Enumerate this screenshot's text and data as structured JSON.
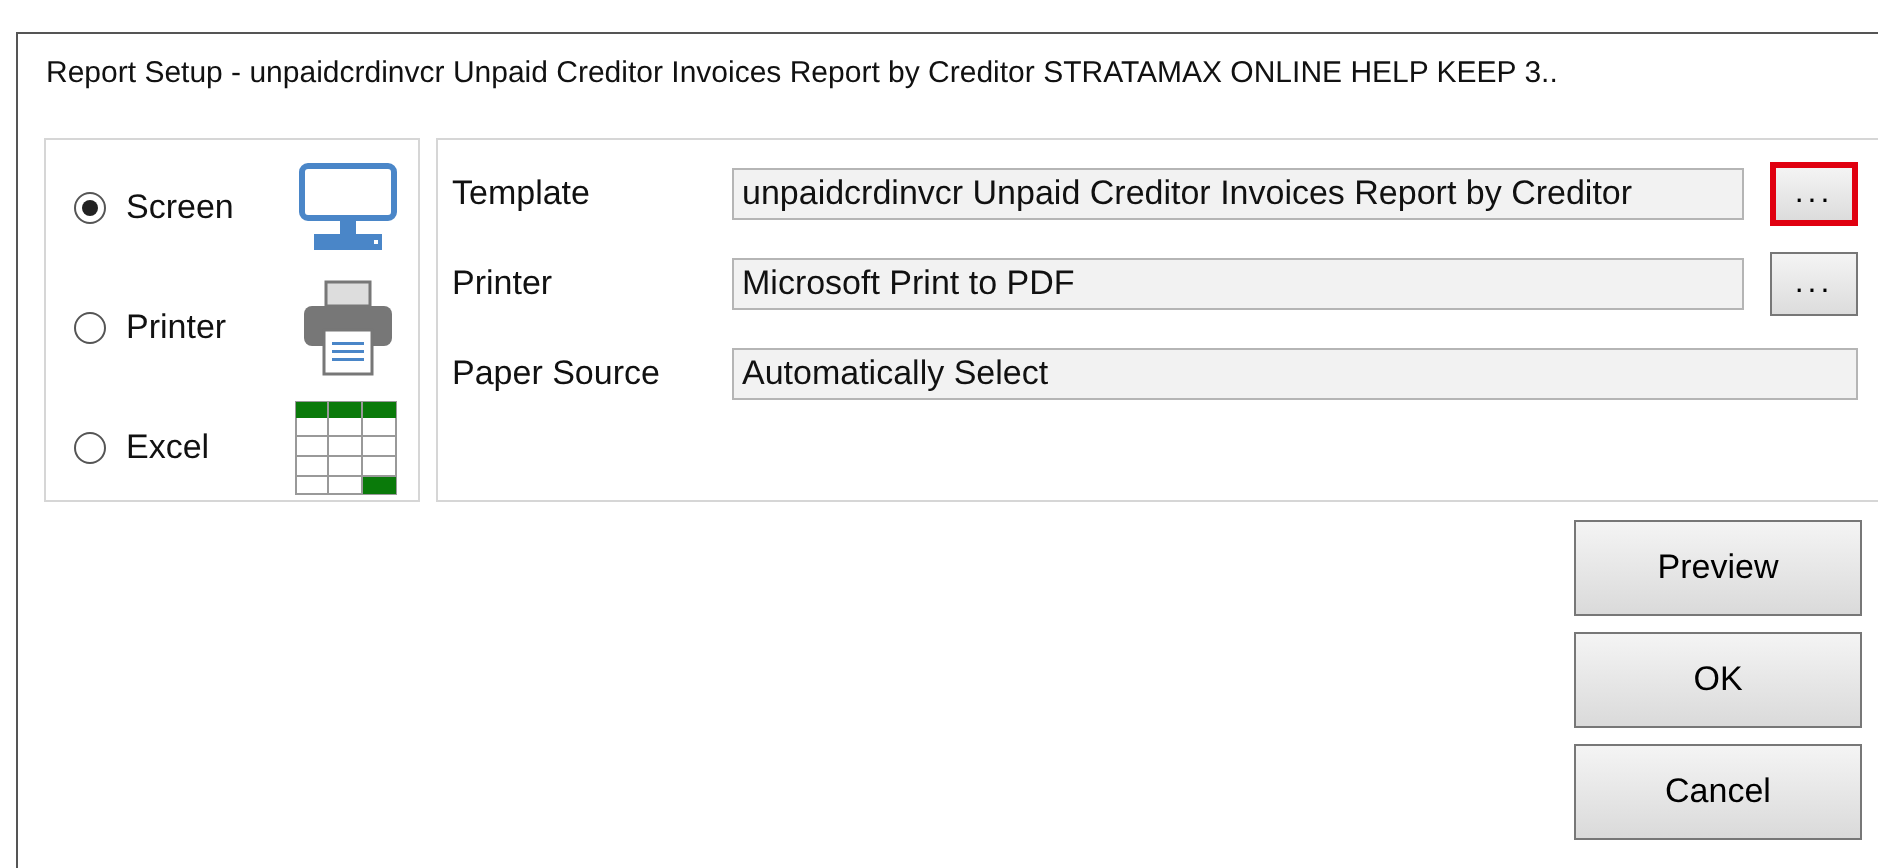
{
  "window": {
    "title": "Report Setup - unpaidcrdinvcr Unpaid Creditor Invoices Report by Creditor STRATAMAX ONLINE HELP KEEP 3.."
  },
  "outputs": [
    {
      "label": "Screen",
      "selected": true,
      "kind": "screen"
    },
    {
      "label": "Printer",
      "selected": false,
      "kind": "printer"
    },
    {
      "label": "Excel",
      "selected": false,
      "kind": "excel"
    }
  ],
  "fields": [
    {
      "label": "Template",
      "value": "unpaidcrdinvcr Unpaid Creditor Invoices Report by Creditor",
      "kind": "browse",
      "button": "...",
      "highlighted": true
    },
    {
      "label": "Printer",
      "value": "Microsoft Print to PDF",
      "kind": "browse",
      "button": "...",
      "highlighted": false
    },
    {
      "label": "Paper Source",
      "value": "Automatically Select",
      "kind": "plain"
    }
  ],
  "buttons": [
    "Preview",
    "OK",
    "Cancel"
  ]
}
